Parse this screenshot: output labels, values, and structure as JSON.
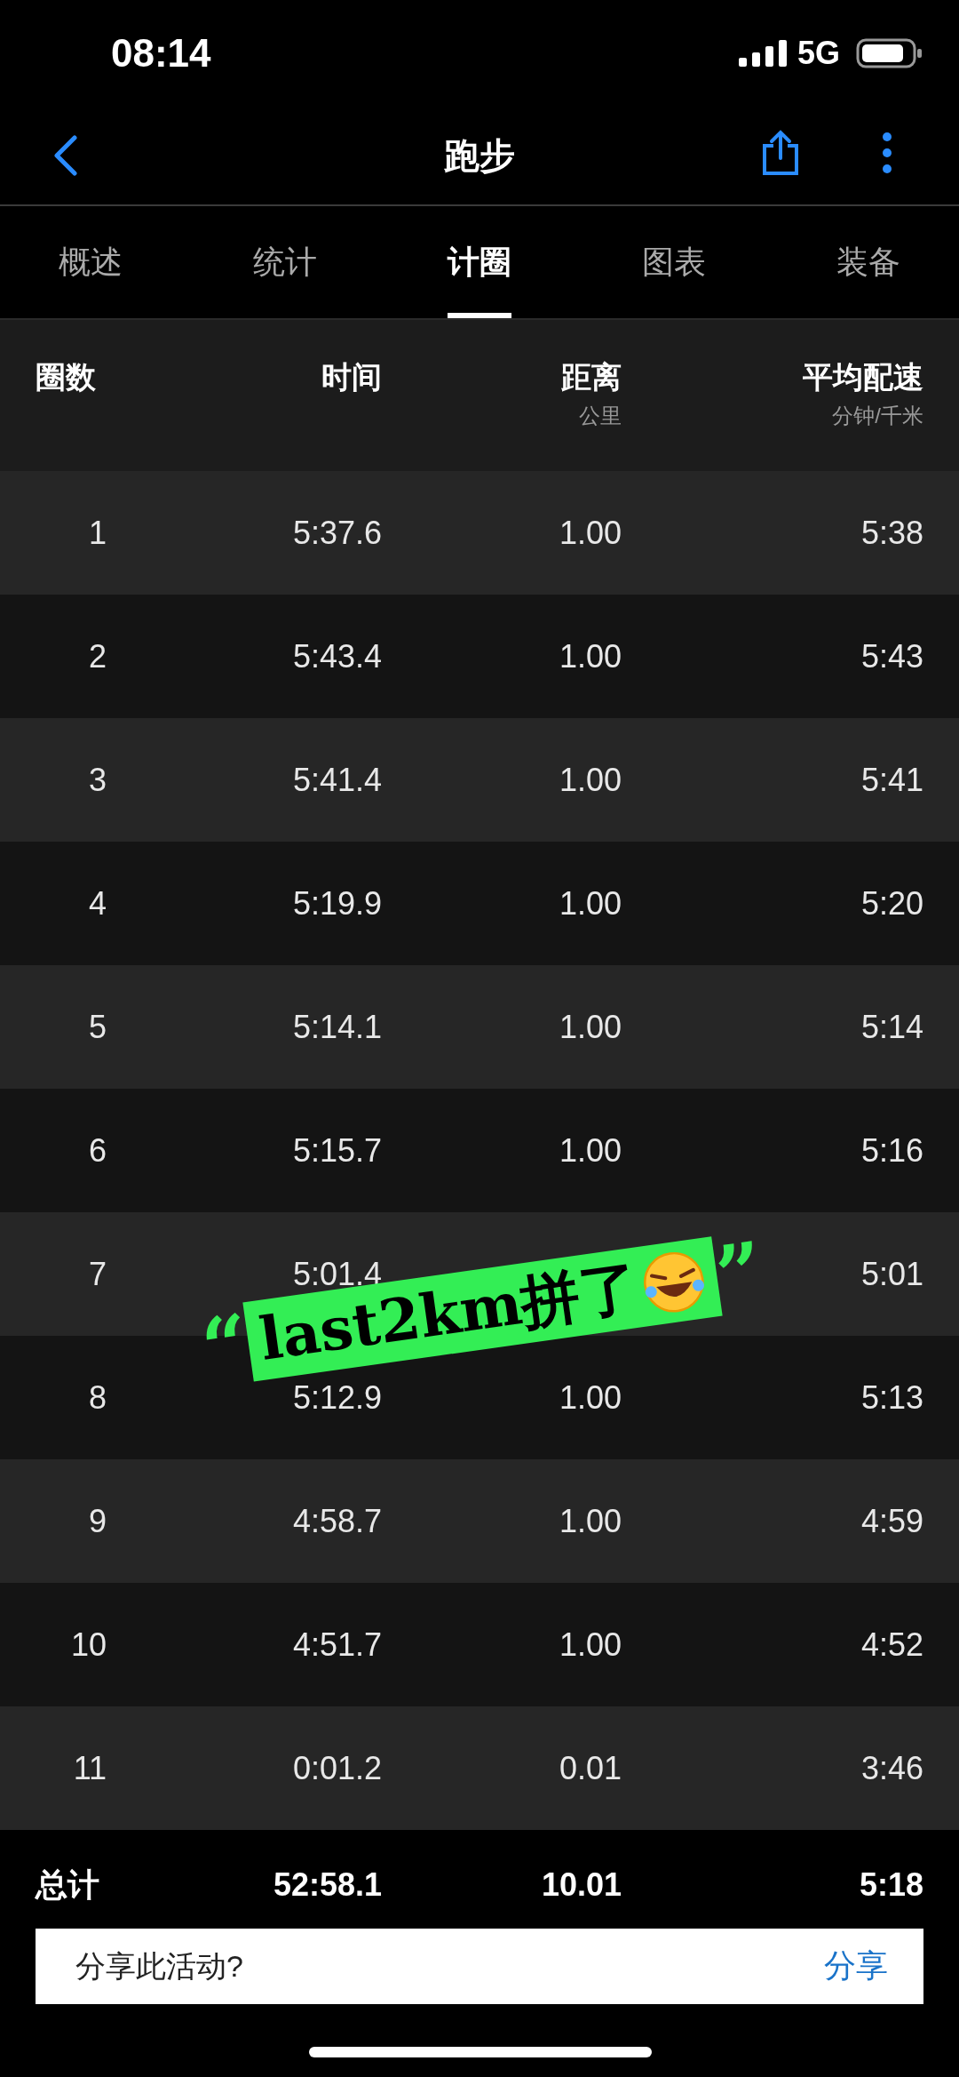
{
  "status_bar": {
    "time": "08:14",
    "network": "5G"
  },
  "nav": {
    "title": "跑步"
  },
  "tabs": [
    {
      "label": "概述",
      "selected": false
    },
    {
      "label": "统计",
      "selected": false
    },
    {
      "label": "计圈",
      "selected": true
    },
    {
      "label": "图表",
      "selected": false
    },
    {
      "label": "装备",
      "selected": false
    }
  ],
  "table": {
    "columns": [
      {
        "label": "圈数"
      },
      {
        "label": "时间"
      },
      {
        "label": "距离",
        "unit": "公里"
      },
      {
        "label": "平均配速",
        "unit": "分钟/千米"
      }
    ],
    "rows": [
      {
        "lap": "1",
        "time": "5:37.6",
        "distance": "1.00",
        "pace": "5:38"
      },
      {
        "lap": "2",
        "time": "5:43.4",
        "distance": "1.00",
        "pace": "5:43"
      },
      {
        "lap": "3",
        "time": "5:41.4",
        "distance": "1.00",
        "pace": "5:41"
      },
      {
        "lap": "4",
        "time": "5:19.9",
        "distance": "1.00",
        "pace": "5:20"
      },
      {
        "lap": "5",
        "time": "5:14.1",
        "distance": "1.00",
        "pace": "5:14"
      },
      {
        "lap": "6",
        "time": "5:15.7",
        "distance": "1.00",
        "pace": "5:16"
      },
      {
        "lap": "7",
        "time": "5:01.4",
        "pace": "5:01"
      },
      {
        "lap": "8",
        "time": "5:12.9",
        "distance": "1.00",
        "pace": "5:13"
      },
      {
        "lap": "9",
        "time": "4:58.7",
        "distance": "1.00",
        "pace": "4:59"
      },
      {
        "lap": "10",
        "time": "4:51.7",
        "distance": "1.00",
        "pace": "4:52"
      },
      {
        "lap": "11",
        "time": "0:01.2",
        "distance": "0.01",
        "pace": "3:46"
      }
    ],
    "total": {
      "label": "总计",
      "time": "52:58.1",
      "distance": "10.01",
      "pace": "5:18"
    }
  },
  "sticker": {
    "open_quote": "“",
    "text": "last2km拼了",
    "close_quote": "”"
  },
  "share_prompt": {
    "text": "分享此活动?",
    "button": "分享"
  }
}
